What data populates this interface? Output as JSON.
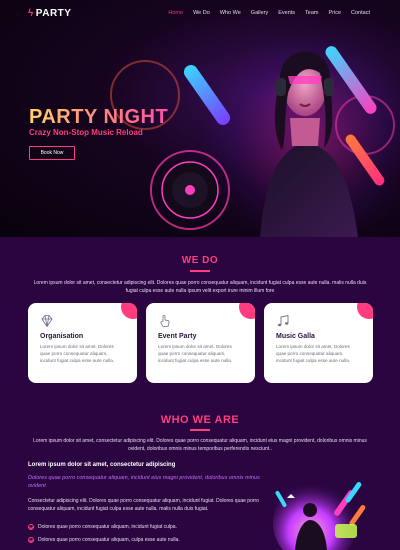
{
  "brand": {
    "name": "PARTY",
    "icon": "bolt-icon"
  },
  "nav": {
    "items": [
      {
        "label": "Home",
        "active": true
      },
      {
        "label": "We Do",
        "active": false
      },
      {
        "label": "Who We",
        "active": false
      },
      {
        "label": "Gallery",
        "active": false
      },
      {
        "label": "Events",
        "active": false
      },
      {
        "label": "Team",
        "active": false
      },
      {
        "label": "Price",
        "active": false
      },
      {
        "label": "Contact",
        "active": false
      }
    ]
  },
  "hero": {
    "title": "PARTY NIGHT",
    "subtitle": "Crazy Non-Stop Music Reload",
    "button": "Book Now"
  },
  "we_do": {
    "title": "WE DO",
    "text": "Lorem ipsum dolor sit amet, consectetur adipiscing elit. Dolores quae porro consequatur aliquam, incidunt fugiat culpa esse aute nulla. malis nulla duis fugiat culpa esse aute nulla ipsum velit export irure minim illum fore",
    "cards": [
      {
        "icon": "diamond-icon",
        "title": "Organisation",
        "text": "Lorem ipsum dolor sit amet, Dolores quae porro consequatur aliquam, incidunt fugiat culpa esse aute nulla."
      },
      {
        "icon": "hand-pointer-icon",
        "title": "Event Party",
        "text": "Lorem ipsum dolor sit amet, Dolores quae porro consequatur aliquam, incidunt fugiat culpa esse aute nulla."
      },
      {
        "icon": "music-note-icon",
        "title": "Music Galla",
        "text": "Lorem ipsum dolor sit amet, Dolores quae porro consequatur aliquam, incidunt fugiat culpa esse aute nulla."
      }
    ]
  },
  "who_we_are": {
    "title": "WHO WE ARE",
    "text": "Lorem ipsum dolor sit amet, consectetur adipiscing elit. Dolores quae porro consequatur aliquam, incidunt eius magni provident, doloribus omnis minus ovident, doloribus omnis minus temporibus perferendis nesciunt..",
    "lead": "Lorem ipsum dolor sit amet, consectetur adipiscing",
    "italic": "Dolores quae porro consequatur aliquam, incidunt eius magni provident, doloribus omnis minus ovident",
    "body": "Consectetur adipiscing elit. Dolores quae porro consequatur aliquam, incidunt fugiat. Dolores quae porro consequatur aliquam, incidunt fugiat culpa esse aute nulla. malis nulla duis fugiat.",
    "bullets": [
      "Dolores quae porro consequatur aliquam, incidunt fugiat culpa.",
      "Dolores quae porro consequatur aliquam, culpa esse aute nulla."
    ]
  },
  "colors": {
    "accent": "#ff3d7f",
    "bg": "#2a0540",
    "card": "#ffffff"
  }
}
